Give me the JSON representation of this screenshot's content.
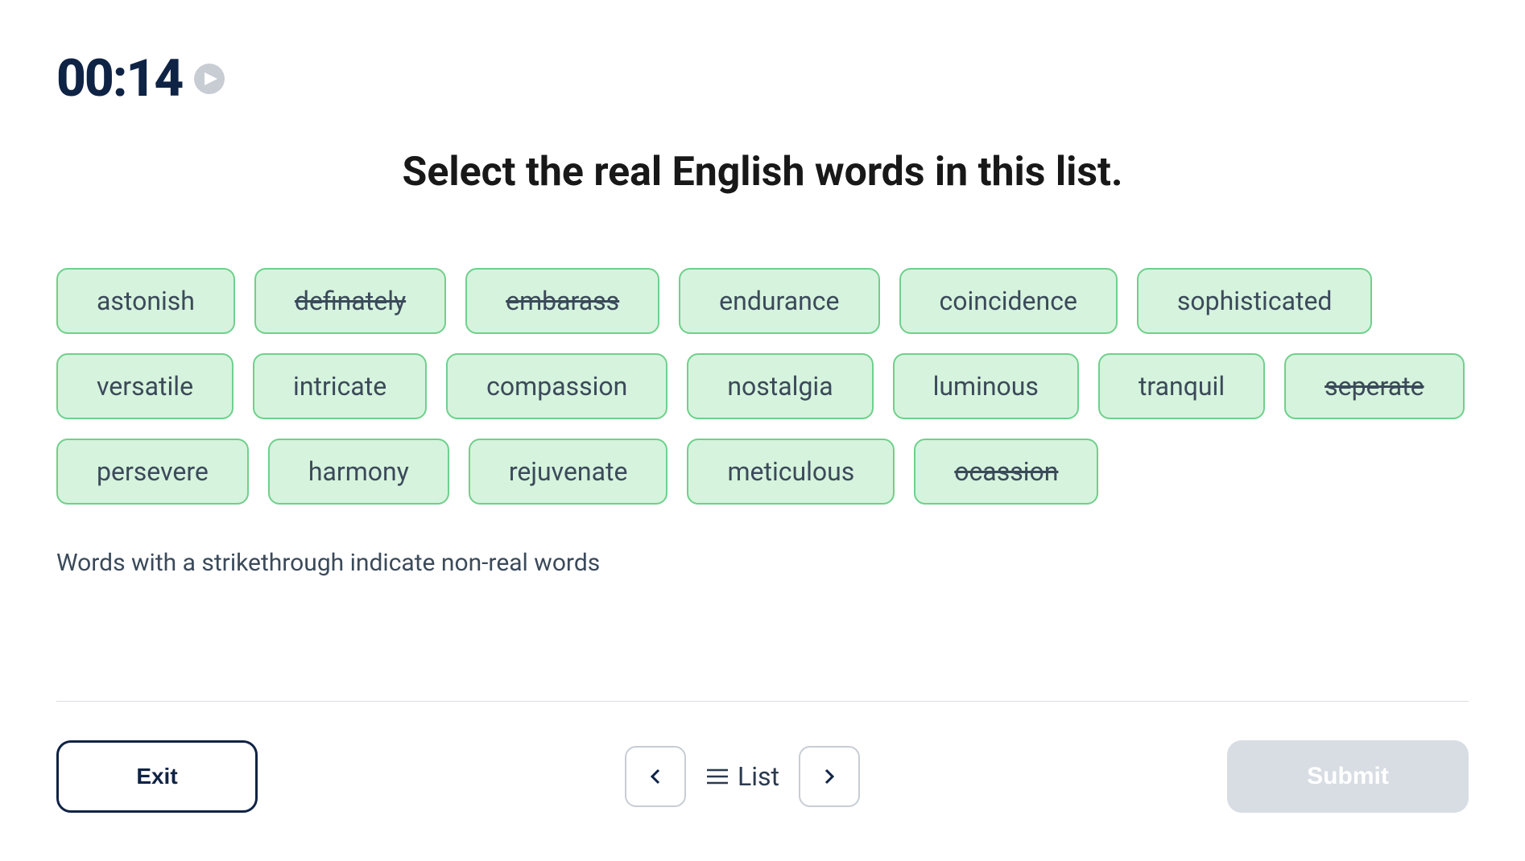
{
  "timer": "00:14",
  "title": "Select the real English words in this list.",
  "words": [
    {
      "text": "astonish",
      "strike": false
    },
    {
      "text": "definately",
      "strike": true
    },
    {
      "text": "embarass",
      "strike": true
    },
    {
      "text": "endurance",
      "strike": false
    },
    {
      "text": "coincidence",
      "strike": false
    },
    {
      "text": "sophisticated",
      "strike": false
    },
    {
      "text": "versatile",
      "strike": false
    },
    {
      "text": "intricate",
      "strike": false
    },
    {
      "text": "compassion",
      "strike": false
    },
    {
      "text": "nostalgia",
      "strike": false
    },
    {
      "text": "luminous",
      "strike": false
    },
    {
      "text": "tranquil",
      "strike": false
    },
    {
      "text": "seperate",
      "strike": true
    },
    {
      "text": "persevere",
      "strike": false
    },
    {
      "text": "harmony",
      "strike": false
    },
    {
      "text": "rejuvenate",
      "strike": false
    },
    {
      "text": "meticulous",
      "strike": false
    },
    {
      "text": "ocassion",
      "strike": true
    }
  ],
  "note": "Words with a strikethrough indicate non-real words",
  "footer": {
    "exit": "Exit",
    "list": "List",
    "submit": "Submit"
  }
}
